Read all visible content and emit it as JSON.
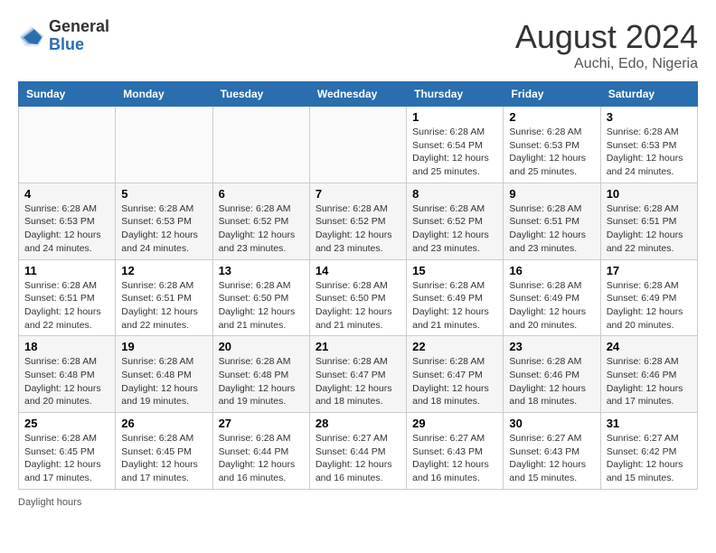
{
  "header": {
    "logo_general": "General",
    "logo_blue": "Blue",
    "month_title": "August 2024",
    "location": "Auchi, Edo, Nigeria"
  },
  "footer": {
    "daylight_label": "Daylight hours"
  },
  "days_of_week": [
    "Sunday",
    "Monday",
    "Tuesday",
    "Wednesday",
    "Thursday",
    "Friday",
    "Saturday"
  ],
  "weeks": [
    [
      {
        "day": "",
        "info": ""
      },
      {
        "day": "",
        "info": ""
      },
      {
        "day": "",
        "info": ""
      },
      {
        "day": "",
        "info": ""
      },
      {
        "day": "1",
        "info": "Sunrise: 6:28 AM\nSunset: 6:54 PM\nDaylight: 12 hours\nand 25 minutes."
      },
      {
        "day": "2",
        "info": "Sunrise: 6:28 AM\nSunset: 6:53 PM\nDaylight: 12 hours\nand 25 minutes."
      },
      {
        "day": "3",
        "info": "Sunrise: 6:28 AM\nSunset: 6:53 PM\nDaylight: 12 hours\nand 24 minutes."
      }
    ],
    [
      {
        "day": "4",
        "info": "Sunrise: 6:28 AM\nSunset: 6:53 PM\nDaylight: 12 hours\nand 24 minutes."
      },
      {
        "day": "5",
        "info": "Sunrise: 6:28 AM\nSunset: 6:53 PM\nDaylight: 12 hours\nand 24 minutes."
      },
      {
        "day": "6",
        "info": "Sunrise: 6:28 AM\nSunset: 6:52 PM\nDaylight: 12 hours\nand 23 minutes."
      },
      {
        "day": "7",
        "info": "Sunrise: 6:28 AM\nSunset: 6:52 PM\nDaylight: 12 hours\nand 23 minutes."
      },
      {
        "day": "8",
        "info": "Sunrise: 6:28 AM\nSunset: 6:52 PM\nDaylight: 12 hours\nand 23 minutes."
      },
      {
        "day": "9",
        "info": "Sunrise: 6:28 AM\nSunset: 6:51 PM\nDaylight: 12 hours\nand 23 minutes."
      },
      {
        "day": "10",
        "info": "Sunrise: 6:28 AM\nSunset: 6:51 PM\nDaylight: 12 hours\nand 22 minutes."
      }
    ],
    [
      {
        "day": "11",
        "info": "Sunrise: 6:28 AM\nSunset: 6:51 PM\nDaylight: 12 hours\nand 22 minutes."
      },
      {
        "day": "12",
        "info": "Sunrise: 6:28 AM\nSunset: 6:51 PM\nDaylight: 12 hours\nand 22 minutes."
      },
      {
        "day": "13",
        "info": "Sunrise: 6:28 AM\nSunset: 6:50 PM\nDaylight: 12 hours\nand 21 minutes."
      },
      {
        "day": "14",
        "info": "Sunrise: 6:28 AM\nSunset: 6:50 PM\nDaylight: 12 hours\nand 21 minutes."
      },
      {
        "day": "15",
        "info": "Sunrise: 6:28 AM\nSunset: 6:49 PM\nDaylight: 12 hours\nand 21 minutes."
      },
      {
        "day": "16",
        "info": "Sunrise: 6:28 AM\nSunset: 6:49 PM\nDaylight: 12 hours\nand 20 minutes."
      },
      {
        "day": "17",
        "info": "Sunrise: 6:28 AM\nSunset: 6:49 PM\nDaylight: 12 hours\nand 20 minutes."
      }
    ],
    [
      {
        "day": "18",
        "info": "Sunrise: 6:28 AM\nSunset: 6:48 PM\nDaylight: 12 hours\nand 20 minutes."
      },
      {
        "day": "19",
        "info": "Sunrise: 6:28 AM\nSunset: 6:48 PM\nDaylight: 12 hours\nand 19 minutes."
      },
      {
        "day": "20",
        "info": "Sunrise: 6:28 AM\nSunset: 6:48 PM\nDaylight: 12 hours\nand 19 minutes."
      },
      {
        "day": "21",
        "info": "Sunrise: 6:28 AM\nSunset: 6:47 PM\nDaylight: 12 hours\nand 18 minutes."
      },
      {
        "day": "22",
        "info": "Sunrise: 6:28 AM\nSunset: 6:47 PM\nDaylight: 12 hours\nand 18 minutes."
      },
      {
        "day": "23",
        "info": "Sunrise: 6:28 AM\nSunset: 6:46 PM\nDaylight: 12 hours\nand 18 minutes."
      },
      {
        "day": "24",
        "info": "Sunrise: 6:28 AM\nSunset: 6:46 PM\nDaylight: 12 hours\nand 17 minutes."
      }
    ],
    [
      {
        "day": "25",
        "info": "Sunrise: 6:28 AM\nSunset: 6:45 PM\nDaylight: 12 hours\nand 17 minutes."
      },
      {
        "day": "26",
        "info": "Sunrise: 6:28 AM\nSunset: 6:45 PM\nDaylight: 12 hours\nand 17 minutes."
      },
      {
        "day": "27",
        "info": "Sunrise: 6:28 AM\nSunset: 6:44 PM\nDaylight: 12 hours\nand 16 minutes."
      },
      {
        "day": "28",
        "info": "Sunrise: 6:27 AM\nSunset: 6:44 PM\nDaylight: 12 hours\nand 16 minutes."
      },
      {
        "day": "29",
        "info": "Sunrise: 6:27 AM\nSunset: 6:43 PM\nDaylight: 12 hours\nand 16 minutes."
      },
      {
        "day": "30",
        "info": "Sunrise: 6:27 AM\nSunset: 6:43 PM\nDaylight: 12 hours\nand 15 minutes."
      },
      {
        "day": "31",
        "info": "Sunrise: 6:27 AM\nSunset: 6:42 PM\nDaylight: 12 hours\nand 15 minutes."
      }
    ]
  ]
}
